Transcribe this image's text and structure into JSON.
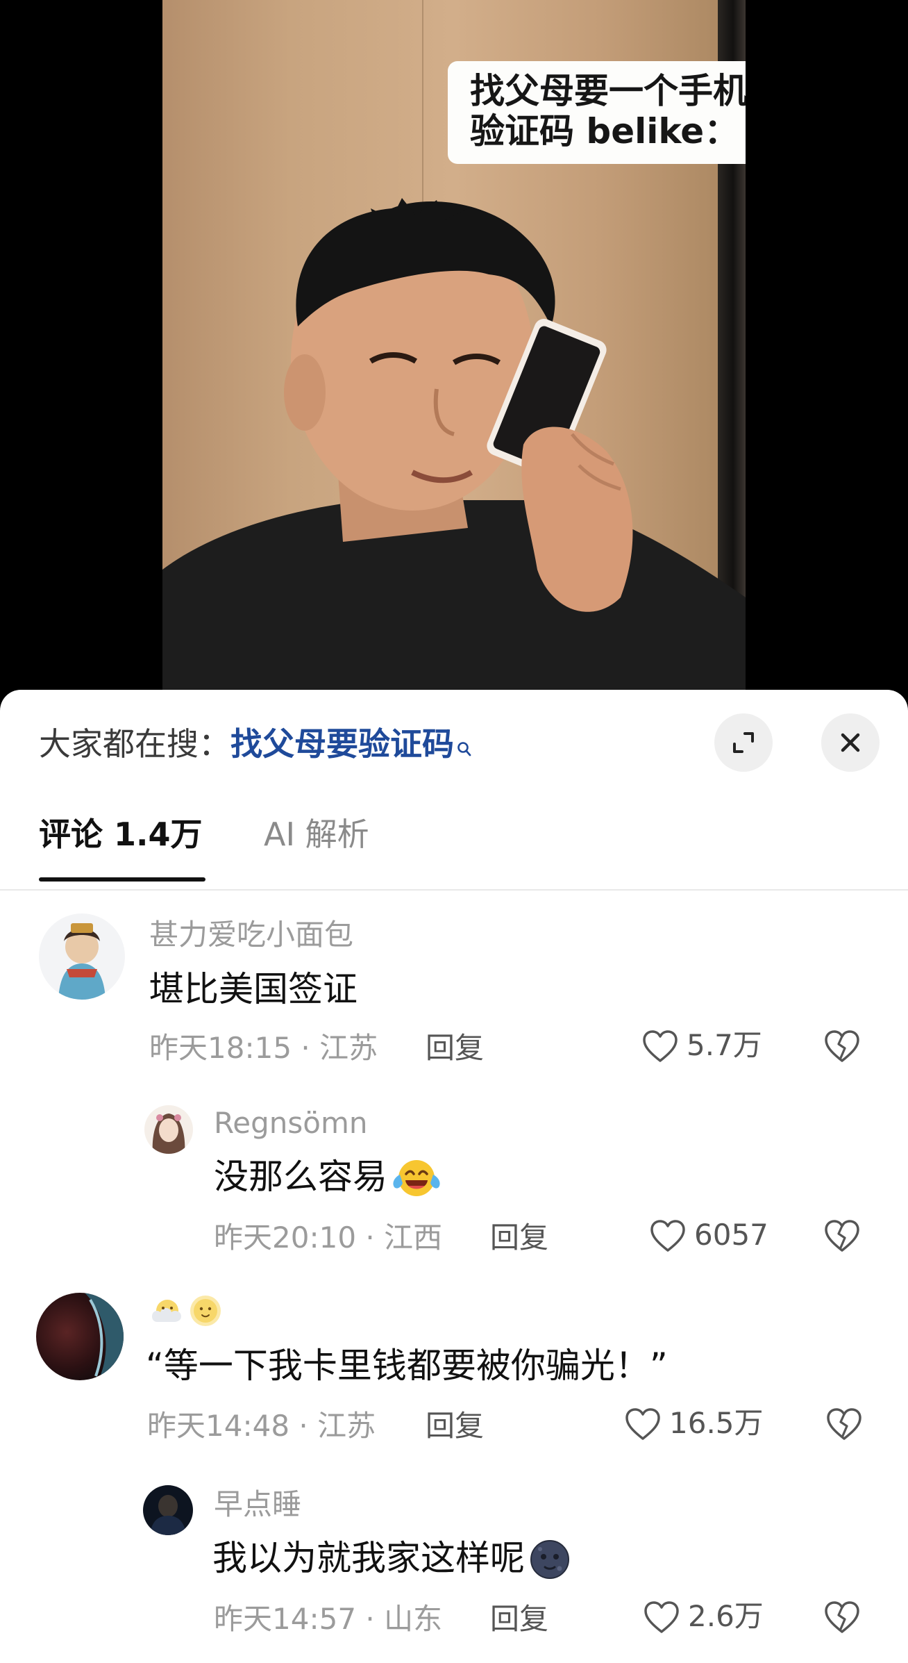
{
  "video": {
    "caption_line1": "找父母要一个手机",
    "caption_line2": "验证码 belike："
  },
  "sheet": {
    "search_prefix": "大家都在搜：",
    "search_term": "找父母要验证码",
    "expand_icon": "expand-icon",
    "close_icon": "close-icon"
  },
  "tabs": {
    "comments_label": "评论 1.4万",
    "ai_label": "AI 解析"
  },
  "comments": [
    {
      "name": "甚力爱吃小面包",
      "text": "堪比美国签证",
      "meta": "昨天18:15 · 江苏",
      "reply_label": "回复",
      "likes": "5.7万"
    },
    {
      "name": "Regnsömn",
      "text": "没那么容易",
      "emoji": "tears-of-joy-emoji",
      "meta": "昨天20:10 · 江西",
      "reply_label": "回复",
      "likes": "6057"
    },
    {
      "name_emoji": [
        "face-in-clouds-emoji",
        "sun-with-face-emoji"
      ],
      "text": "“等一下我卡里钱都要被你骗光！”",
      "meta": "昨天14:48 · 江苏",
      "reply_label": "回复",
      "likes": "16.5万"
    },
    {
      "name": "早点睡",
      "text": "我以为就我家这样呢",
      "emoji": "new-moon-face-emoji",
      "meta": "昨天14:57 · 山东",
      "reply_label": "回复",
      "likes": "2.6万"
    }
  ],
  "colors": {
    "search_term": "#1f4a9a",
    "muted_text": "#9b9b9b",
    "primary_text": "#111111"
  }
}
